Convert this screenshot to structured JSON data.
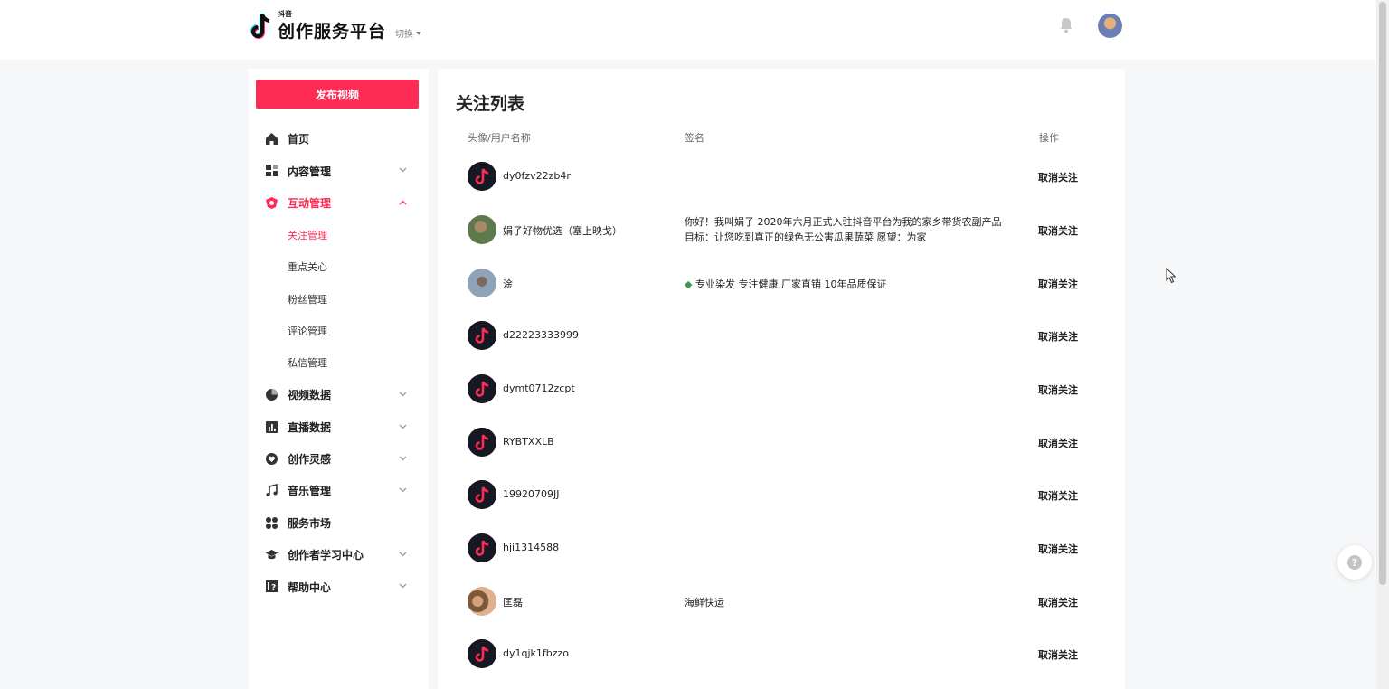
{
  "header": {
    "logo_small": "抖音",
    "logo_title": "创作服务平台",
    "switch_label": "切换"
  },
  "sidebar": {
    "publish_label": "发布视频",
    "items": [
      {
        "label": "首页",
        "icon": "home-icon"
      },
      {
        "label": "内容管理",
        "icon": "grid-icon"
      },
      {
        "label": "互动管理",
        "icon": "interact-icon"
      },
      {
        "label": "视频数据",
        "icon": "pie-chart-icon"
      },
      {
        "label": "直播数据",
        "icon": "bar-chart-icon"
      },
      {
        "label": "创作灵感",
        "icon": "heart-icon"
      },
      {
        "label": "音乐管理",
        "icon": "music-note-icon"
      },
      {
        "label": "服务市场",
        "icon": "apps-icon"
      },
      {
        "label": "创作者学习中心",
        "icon": "graduation-cap-icon"
      },
      {
        "label": "帮助中心",
        "icon": "help-book-icon"
      }
    ],
    "sub_items": [
      "关注管理",
      "重点关心",
      "粉丝管理",
      "评论管理",
      "私信管理"
    ]
  },
  "main": {
    "title": "关注列表",
    "columns": [
      "头像/用户名称",
      "签名",
      "操作"
    ],
    "rows": [
      {
        "name": "dy0fzv22zb4r",
        "signature": "",
        "action": "取消关注"
      },
      {
        "name": "娟子好物优选（塞上映戈）",
        "signature": "你好！我叫娟子 2020年六月正式入驻抖音平台为我的家乡带货农副产品",
        "signature2": "目标：让您吃到真正的绿色无公害瓜果蔬菜 愿望：为家",
        "action": "取消关注"
      },
      {
        "name": "淦",
        "signature": "专业染发 专注健康  厂家直销 10年品质保证",
        "action": "取消关注"
      },
      {
        "name": "d22223333999",
        "signature": "",
        "action": "取消关注"
      },
      {
        "name": "dymt0712zcpt",
        "signature": "",
        "action": "取消关注"
      },
      {
        "name": "RYBTXXLB",
        "signature": "",
        "action": "取消关注"
      },
      {
        "name": "19920709JJ",
        "signature": "",
        "action": "取消关注"
      },
      {
        "name": "hji1314588",
        "signature": "",
        "action": "取消关注"
      },
      {
        "name": "匡磊",
        "signature": "海鲜快运",
        "action": "取消关注"
      },
      {
        "name": "dy1qjk1fbzzo",
        "signature": "",
        "action": "取消关注"
      }
    ]
  },
  "colors": {
    "accent": "#fe2c55"
  }
}
